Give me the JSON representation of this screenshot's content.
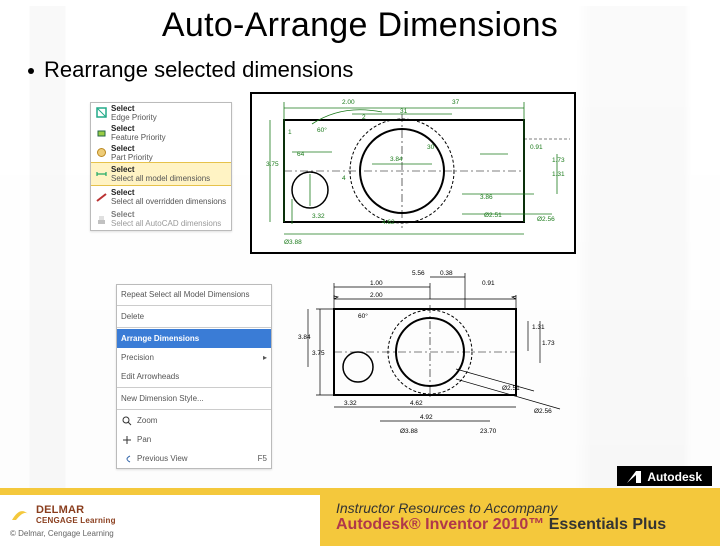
{
  "title": "Auto-Arrange Dimensions",
  "bullets": [
    "Rearrange selected dimensions"
  ],
  "panel1": {
    "rows": [
      {
        "t1": "Select",
        "t2": "Edge Priority"
      },
      {
        "t1": "Select",
        "t2": "Feature Priority"
      },
      {
        "t1": "Select",
        "t2": "Part Priority"
      },
      {
        "t1": "Select",
        "t2": "Select all model dimensions",
        "sel": true
      },
      {
        "t1": "Select",
        "t2": "Select all overridden dimensions"
      },
      {
        "t1": "Select",
        "t2": "Select all AutoCAD dimensions"
      }
    ]
  },
  "panel2": {
    "rows": [
      {
        "t1": "Repeat Select all Model Dimensions"
      },
      {
        "t1": "Delete"
      },
      {
        "t1": "Arrange Dimensions",
        "sel": true
      },
      {
        "t1": "Precision",
        "t2": "▸"
      },
      {
        "t1": "Edit Arrowheads"
      },
      {
        "t1": "New Dimension Style..."
      },
      {
        "t1": "Zoom"
      },
      {
        "t1": "Pan"
      },
      {
        "t1": "Previous View",
        "t2": "F5"
      }
    ]
  },
  "drawing1": {
    "dims": [
      "37",
      "2.00",
      "31",
      "2",
      "1",
      "60°",
      "64",
      "3.84",
      "30",
      "0.91",
      "1.73",
      "1.31",
      "3.75",
      "4",
      "3.32",
      "4.62",
      "3.86",
      "2.51",
      "2.56",
      "3.88"
    ],
    "prefixed": {
      "v1": "Ø3.88",
      "v2": "Ø2.51",
      "v3": "Ø2.56"
    }
  },
  "drawing2": {
    "dims": [
      "5.56",
      "1.00",
      "0.38",
      "0.91",
      "2.00",
      "60°",
      "1.31",
      "3.75",
      "3.84",
      "1.73",
      "3.32",
      "4.62",
      "4.92",
      "23.70",
      "Ø3.88",
      "Ø2.51",
      "Ø2.56"
    ]
  },
  "footer": {
    "brand1": "DELMAR",
    "brand2": "CENGAGE Learning",
    "copy": "©  Delmar, Cengage Learning",
    "line1": "Instructor Resources to Accompany",
    "line2_prod": "Autodesk® Inventor 2010™",
    "line2_rest": " Essentials Plus",
    "autodesk": "Autodesk"
  }
}
